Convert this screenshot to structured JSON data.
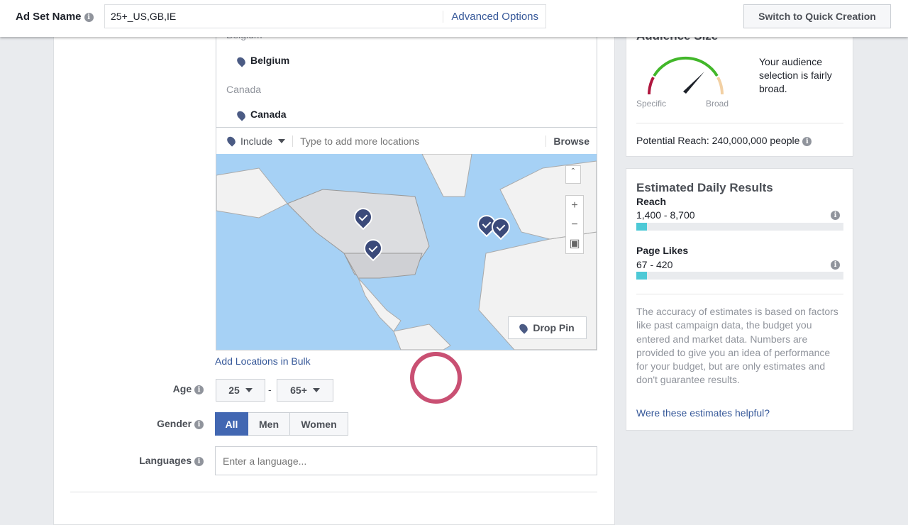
{
  "header": {
    "ad_set_label": "Ad Set Name",
    "ad_set_value": "25+_US,GB,IE",
    "advanced_options": "Advanced Options",
    "switch_button": "Switch to Quick Creation"
  },
  "locations": {
    "items": [
      {
        "group": "Belgium",
        "name": "Belgium"
      },
      {
        "group": "Canada",
        "name": "Canada"
      }
    ],
    "include_label": "Include",
    "placeholder": "Type to add more locations",
    "browse": "Browse",
    "drop_pin": "Drop Pin",
    "bulk_link": "Add Locations in Bulk"
  },
  "age": {
    "label": "Age",
    "min": "25",
    "max": "65+",
    "separator": "-"
  },
  "gender": {
    "label": "Gender",
    "options": [
      "All",
      "Men",
      "Women"
    ],
    "selected": "All"
  },
  "languages": {
    "label": "Languages",
    "placeholder": "Enter a language..."
  },
  "audience": {
    "title": "Audience Size",
    "specific": "Specific",
    "broad": "Broad",
    "description": "Your audience selection is fairly broad.",
    "potential_reach": "Potential Reach: 240,000,000 people"
  },
  "estimates": {
    "title": "Estimated Daily Results",
    "reach_label": "Reach",
    "reach_value": "1,400 - 8,700",
    "reach_fill_pct": 5,
    "likes_label": "Page Likes",
    "likes_value": "67 - 420",
    "likes_fill_pct": 5,
    "disclaimer": "The accuracy of estimates is based on factors like past campaign data, the budget you entered and market data. Numbers are provided to give you an idea of performance for your budget, but are only estimates and don't guarantee results.",
    "helpful_link": "Were these estimates helpful?"
  },
  "colors": {
    "accent": "#4267b2",
    "link": "#365899",
    "bar": "#4dc9d6"
  }
}
